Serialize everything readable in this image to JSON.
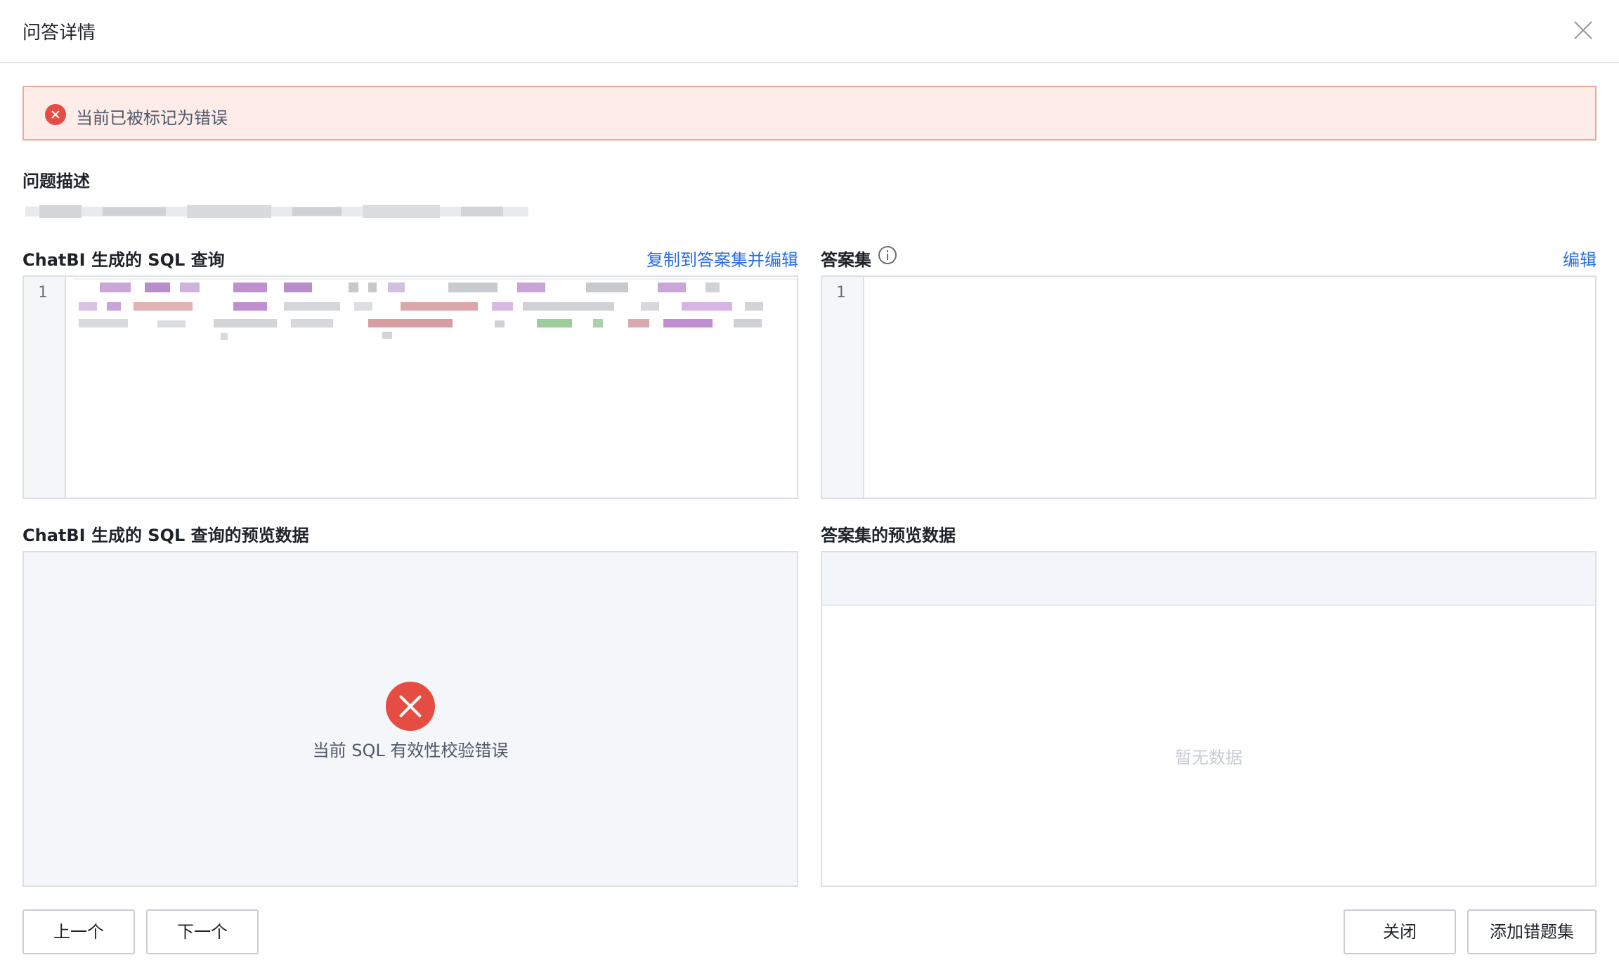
{
  "header": {
    "title": "问答详情"
  },
  "alert": {
    "text": "当前已被标记为错误"
  },
  "question": {
    "label": "问题描述"
  },
  "sql": {
    "label": "ChatBI 生成的 SQL 查询",
    "copy_link": "复制到答案集并编辑",
    "line_number": "1"
  },
  "answer_set": {
    "label": "答案集",
    "edit_link": "编辑",
    "line_number": "1"
  },
  "sql_preview": {
    "label": "ChatBI 生成的 SQL 查询的预览数据",
    "error_message": "当前 SQL 有效性校验错误"
  },
  "answer_preview": {
    "label": "答案集的预览数据",
    "empty_text": "暂无数据"
  },
  "footer": {
    "prev_label": "上一个",
    "next_label": "下一个",
    "close_label": "关闭",
    "add_label": "添加错题集"
  },
  "colors": {
    "error": "#e54d42",
    "link": "#2b6fe0",
    "alert_bg": "#fdece8"
  }
}
